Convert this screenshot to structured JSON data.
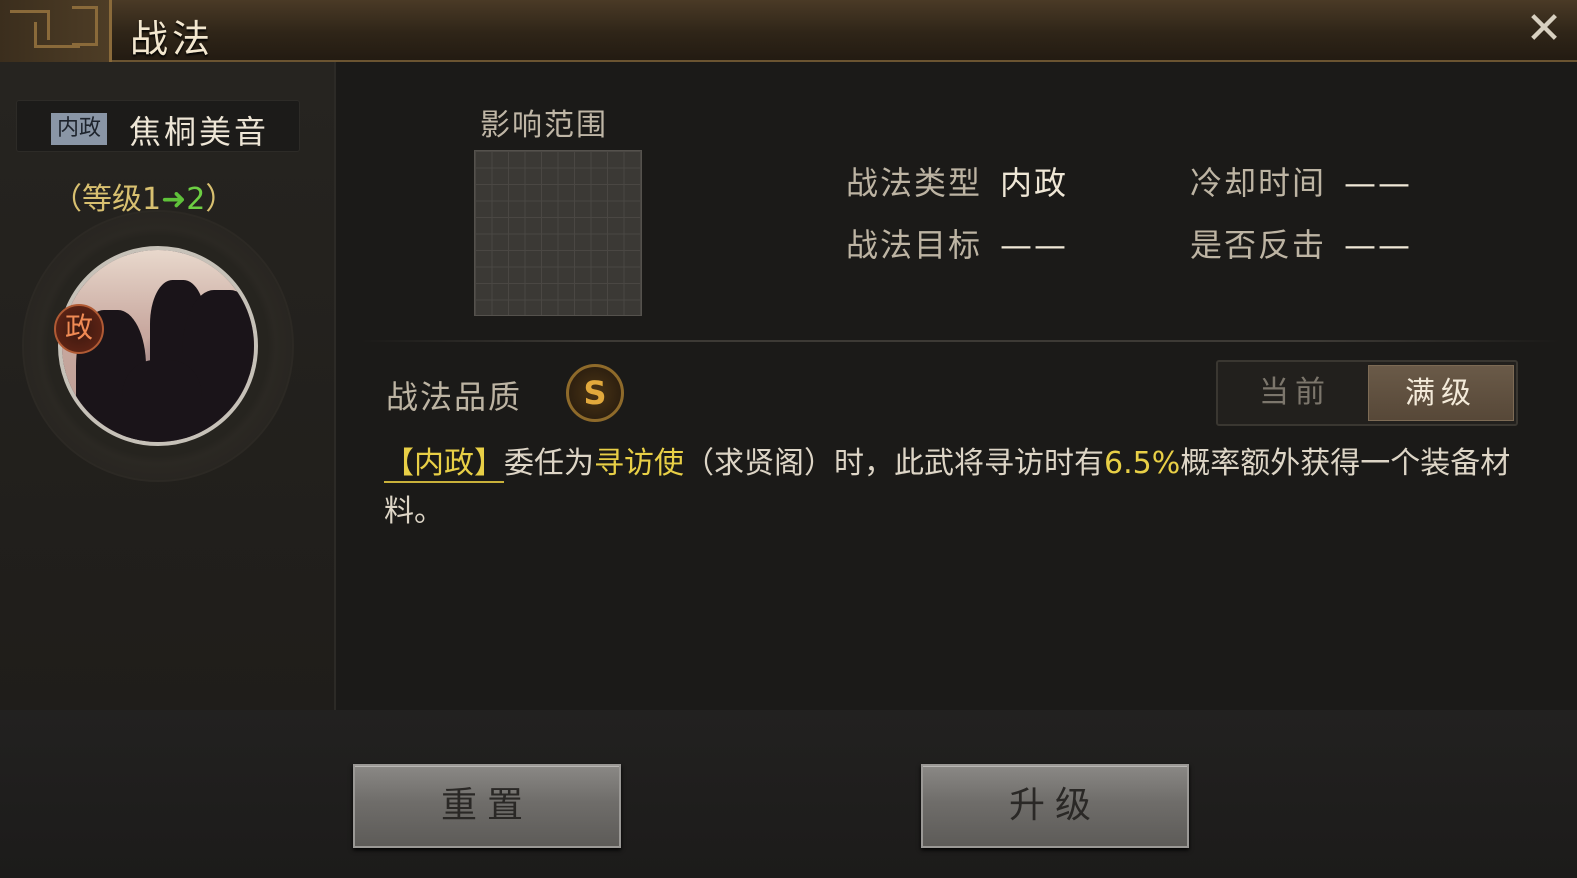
{
  "window": {
    "title": "战法",
    "close_icon": "close-icon"
  },
  "skill": {
    "type_tag": "内政",
    "name": "焦桐美音",
    "level_open": "（等级",
    "level_from": "1",
    "level_to": "2",
    "level_close": "）",
    "portrait_badge": "政"
  },
  "range": {
    "label": "影响范围"
  },
  "attributes": {
    "type_label": "战法类型",
    "type_value": "内政",
    "target_label": "战法目标",
    "target_value": "——",
    "cooldown_label": "冷却时间",
    "cooldown_value": "——",
    "counter_label": "是否反击",
    "counter_value": "——"
  },
  "quality": {
    "label": "战法品质",
    "grade": "S"
  },
  "toggle": {
    "current": "当前",
    "max": "满级",
    "selected": "满级"
  },
  "description": {
    "tag": "【内政】",
    "part1": "委任为",
    "role": "寻访使",
    "part2": "（求贤阁）时，此武将寻访时有",
    "rate": "6.5%",
    "part3": "概率额外获得一个装备材料。"
  },
  "buttons": {
    "reset": "重置",
    "upgrade": "升级"
  },
  "colors": {
    "accent_yellow": "#e8cf46",
    "level_green": "#6dcf43",
    "quality_gold": "#e2a93c",
    "type_tag_bg": "#8a96a6"
  }
}
